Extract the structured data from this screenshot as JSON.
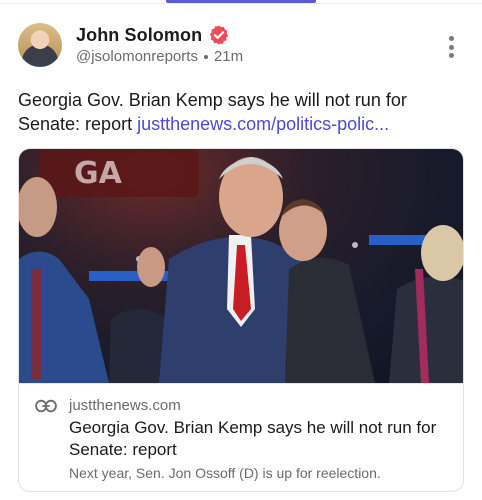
{
  "post": {
    "author": {
      "name": "John Solomon",
      "handle": "@jsolomonreports",
      "time": "21m",
      "verified": true
    },
    "text": "Georgia Gov. Brian Kemp says he will not run for Senate: report",
    "link_text": "justthenews.com/politics-polic...",
    "link_card": {
      "domain": "justthenews.com",
      "title": "Georgia Gov. Brian Kemp says he will not run for Senate: report",
      "description": "Next year, Sen. Jon Ossoff (D) is up for reelection."
    }
  },
  "colors": {
    "accent": "#5b5bd6",
    "link": "#4a4ad6",
    "verified_badge": "#ef4a5a",
    "muted_text": "#6b6b6b"
  },
  "icons": {
    "verified": "verified-badge-icon",
    "more": "more-vertical-icon",
    "link": "link-icon"
  }
}
